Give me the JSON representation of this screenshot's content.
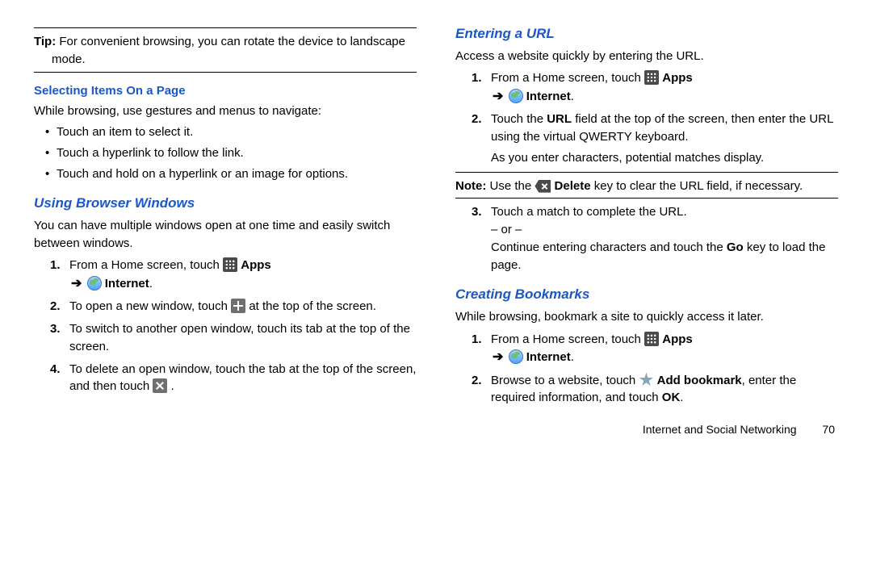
{
  "left": {
    "tip": {
      "label": "Tip:",
      "text": "For convenient browsing, you can rotate the device to landscape mode."
    },
    "selecting": {
      "title": "Selecting Items On a Page",
      "intro": "While browsing, use gestures and menus to navigate:",
      "b1": "Touch an item to select it.",
      "b2": "Touch a hyperlink to follow the link.",
      "b3": "Touch and hold on a hyperlink or an image for options."
    },
    "windows": {
      "title": "Using Browser Windows",
      "intro": "You can have multiple windows open at one time and easily switch between windows.",
      "s1a": "From a Home screen, touch ",
      "apps": "Apps",
      "internet": "Internet",
      "s2a": "To open a new window, touch ",
      "s2b": " at the top of the screen.",
      "s3": "To switch to another open window, touch its tab at the top of the screen.",
      "s4a": "To delete an open window, touch the tab at the top of the screen, and then touch ",
      "s4b": "."
    }
  },
  "right": {
    "url": {
      "title": "Entering a URL",
      "intro": "Access a website quickly by entering the URL.",
      "s1a": "From a Home screen, touch ",
      "apps": "Apps",
      "internet": "Internet",
      "s2a": "Touch the ",
      "urlLbl": "URL",
      "s2b": " field at the top of the screen, then enter the URL using the virtual QWERTY keyboard.",
      "s2c": "As you enter characters, potential matches display.",
      "noteLbl": "Note:",
      "noteA": "Use the ",
      "delete": "Delete",
      "noteB": " key to clear the URL field, if necessary.",
      "s3a": "Touch a match to complete the URL.",
      "or": "– or –",
      "s3b": "Continue entering characters and touch the ",
      "go": "Go",
      "s3c": " key to load the page."
    },
    "bookmarks": {
      "title": "Creating Bookmarks",
      "intro": "While browsing, bookmark a site to quickly access it later.",
      "s1a": "From a Home screen, touch ",
      "apps": "Apps",
      "internet": "Internet",
      "s2a": "Browse to a website, touch ",
      "add": "Add bookmark",
      "s2b": ", enter the required information, and touch ",
      "ok": "OK",
      "s2c": "."
    }
  },
  "footer": {
    "chapter": "Internet and Social Networking",
    "page": "70"
  }
}
